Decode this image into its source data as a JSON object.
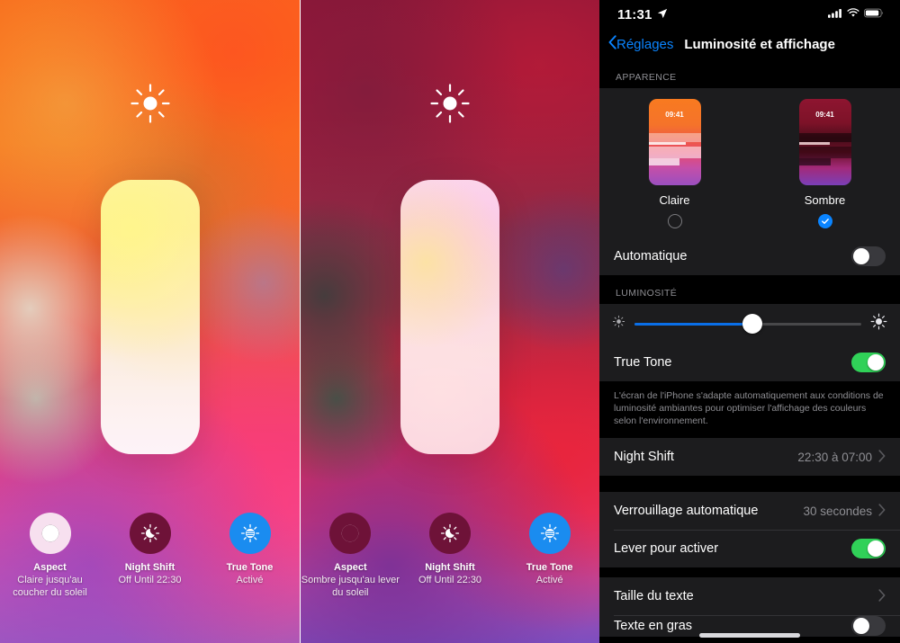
{
  "panels": {
    "light": {
      "name": "control-center-light",
      "sun_icon": "sun-icon",
      "brightness_slider_label": "brightness-slider",
      "buttons": [
        {
          "icon": "appearance-contrast-icon",
          "title": "Aspect",
          "subtitle": "Claire jusqu'au coucher du soleil"
        },
        {
          "icon": "night-shift-icon",
          "title": "Night Shift",
          "subtitle": "Off Until 22:30"
        },
        {
          "icon": "true-tone-icon",
          "title": "True Tone",
          "subtitle": "Activé"
        }
      ]
    },
    "dark": {
      "name": "control-center-dark",
      "sun_icon": "sun-icon",
      "brightness_slider_label": "brightness-slider",
      "buttons": [
        {
          "icon": "appearance-contrast-icon",
          "title": "Aspect",
          "subtitle": "Sombre jusqu'au lever du soleil"
        },
        {
          "icon": "night-shift-icon",
          "title": "Night Shift",
          "subtitle": "Off Until 22:30"
        },
        {
          "icon": "true-tone-icon",
          "title": "True Tone",
          "subtitle": "Activé"
        }
      ]
    }
  },
  "settings": {
    "status_bar": {
      "time": "11:31",
      "location_icon": "location-arrow-icon",
      "cellular_icon": "cellular-signal-icon",
      "wifi_icon": "wifi-icon",
      "battery_icon": "battery-icon"
    },
    "nav": {
      "back_label": "Réglages",
      "back_icon": "chevron-left-icon",
      "title": "Luminosité et affichage"
    },
    "appearance": {
      "header": "APPARENCE",
      "options": [
        {
          "label": "Claire",
          "time": "09:41",
          "selected": false
        },
        {
          "label": "Sombre",
          "time": "09:41",
          "selected": true
        }
      ],
      "automatic": {
        "label": "Automatique",
        "value": "off"
      }
    },
    "brightness": {
      "header": "LUMINOSITÉ",
      "low_icon": "brightness-low-icon",
      "high_icon": "brightness-high-icon",
      "level_percent": 52,
      "true_tone": {
        "label": "True Tone",
        "value": "on"
      },
      "true_tone_footnote": "L'écran de l'iPhone s'adapte automatiquement aux conditions de luminosité ambiantes pour optimiser l'affichage des couleurs selon l'environnement.",
      "night_shift": {
        "label": "Night Shift",
        "value": "22:30 à 07:00"
      }
    },
    "lock": {
      "auto_lock": {
        "label": "Verrouillage automatique",
        "value": "30 secondes"
      },
      "raise_to_wake": {
        "label": "Lever pour activer",
        "value": "on"
      }
    },
    "text": {
      "text_size": {
        "label": "Taille du texte"
      },
      "bold_text": {
        "label": "Texte en gras",
        "value": "off"
      }
    }
  },
  "colors": {
    "accent_blue": "#0a84ff",
    "slider_blue": "#0a6fe8",
    "toggle_green": "#30d158",
    "group_bg": "#1c1c1e",
    "secondary_text": "#8e8e93",
    "true_tone_button": "#1a8cf0",
    "night_shift_button": "#6e1238"
  }
}
